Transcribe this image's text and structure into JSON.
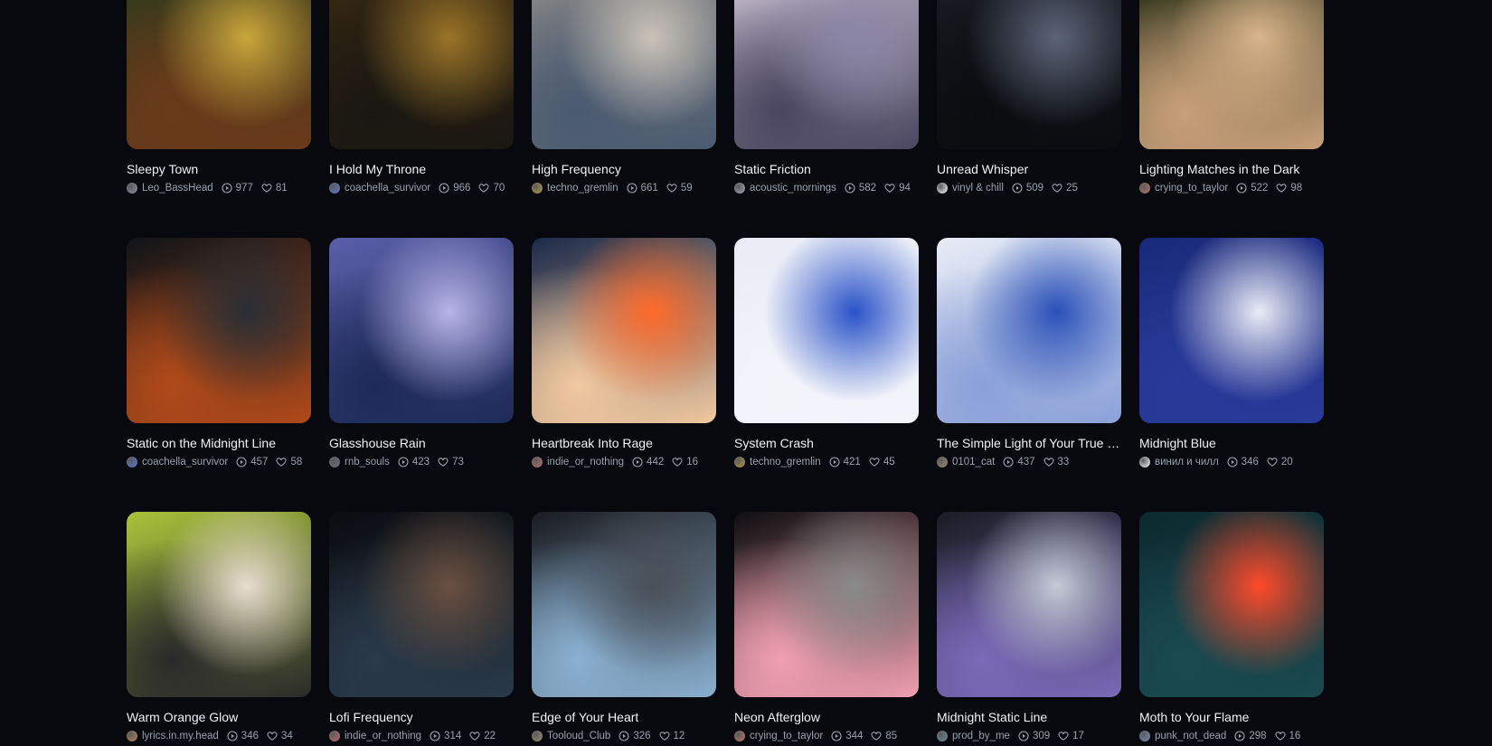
{
  "tracks": [
    {
      "title": "Sleepy Town",
      "author": "Leo_BassHead",
      "plays": "977",
      "likes": "81",
      "art": [
        "#2c3a1c",
        "#c9a63b",
        "#6b3a1a"
      ],
      "avatar": "#8a8f99"
    },
    {
      "title": "I Hold My Throne",
      "author": "coachella_survivor",
      "plays": "966",
      "likes": "70",
      "art": [
        "#3a2a12",
        "#9a7428",
        "#1a1712"
      ],
      "avatar": "#5b7bd6"
    },
    {
      "title": "High Frequency",
      "author": "techno_gremlin",
      "plays": "661",
      "likes": "59",
      "art": [
        "#8c8a86",
        "#c9c2b8",
        "#4a5a70"
      ],
      "avatar": "#b59a3a"
    },
    {
      "title": "Static Friction",
      "author": "acoustic_mornings",
      "plays": "582",
      "likes": "94",
      "art": [
        "#cfc6d6",
        "#8b86a6",
        "#4a4660"
      ],
      "avatar": "#a0a4ab"
    },
    {
      "title": "Unread Whisper",
      "author": "vinyl & chill",
      "plays": "509",
      "likes": "25",
      "art": [
        "#1a1d24",
        "#5b6478",
        "#0b0c10"
      ],
      "avatar": "#ffffff"
    },
    {
      "title": "Lighting Matches in the Dark",
      "author": "crying_to_taylor",
      "plays": "522",
      "likes": "98",
      "art": [
        "#1f2810",
        "#d9b48a",
        "#c8a07a"
      ],
      "avatar": "#c07060"
    },
    {
      "title": "Static on the Midnight Line",
      "author": "coachella_survivor",
      "plays": "457",
      "likes": "58",
      "art": [
        "#101418",
        "#2a2f36",
        "#b04a1a"
      ],
      "avatar": "#5b7bd6"
    },
    {
      "title": "Glasshouse Rain",
      "author": "rnb_souls",
      "plays": "423",
      "likes": "73",
      "art": [
        "#5a5fa8",
        "#b7b4e8",
        "#1e2a58"
      ],
      "avatar": "#6a6f78"
    },
    {
      "title": "Heartbreak Into Rage",
      "author": "indie_or_nothing",
      "plays": "442",
      "likes": "16",
      "art": [
        "#1b2a4a",
        "#ff6a2a",
        "#f2c9a0"
      ],
      "avatar": "#c06a70"
    },
    {
      "title": "System Crash",
      "author": "techno_gremlin",
      "plays": "421",
      "likes": "45",
      "art": [
        "#e9ecf6",
        "#2a52c8",
        "#f2f4fa"
      ],
      "avatar": "#b59a3a"
    },
    {
      "title": "The Simple Light of Your True Self",
      "author": "0101_cat",
      "plays": "437",
      "likes": "33",
      "art": [
        "#e8ecf6",
        "#2a50b8",
        "#8aa0d8"
      ],
      "avatar": "#a08a70"
    },
    {
      "title": "Midnight Blue",
      "author": "винил и чилл",
      "plays": "346",
      "likes": "20",
      "art": [
        "#1a2a7a",
        "#e9ecf6",
        "#2a3a9a"
      ],
      "avatar": "#ffffff"
    },
    {
      "title": "Warm Orange Glow",
      "author": "lyrics.in.my.head",
      "plays": "346",
      "likes": "34",
      "art": [
        "#a9c23a",
        "#e9ddd0",
        "#2a2a2a"
      ],
      "avatar": "#c08050"
    },
    {
      "title": "Lofi Frequency",
      "author": "indie_or_nothing",
      "plays": "314",
      "likes": "22",
      "art": [
        "#0a0c10",
        "#6a5040",
        "#2a3a4a"
      ],
      "avatar": "#c06a70"
    },
    {
      "title": "Edge of Your Heart",
      "author": "Tooloud_Club",
      "plays": "326",
      "likes": "12",
      "art": [
        "#1a1c20",
        "#4a5058",
        "#8ab0d0"
      ],
      "avatar": "#9a8a6a"
    },
    {
      "title": "Neon Afterglow",
      "author": "crying_to_taylor",
      "plays": "344",
      "likes": "85",
      "art": [
        "#0e0e10",
        "#8a8a8a",
        "#f0a0b0"
      ],
      "avatar": "#c07060"
    },
    {
      "title": "Midnight Static Line",
      "author": "prod_by_me",
      "plays": "309",
      "likes": "17",
      "art": [
        "#1a1c24",
        "#c4cad6",
        "#7a6ab8"
      ],
      "avatar": "#6a8aa0"
    },
    {
      "title": "Moth to Your Flame",
      "author": "punk_not_dead",
      "plays": "298",
      "likes": "16",
      "art": [
        "#0c2a30",
        "#ff4a2a",
        "#1a4a50"
      ],
      "avatar": "#7a8ab0"
    }
  ],
  "icons": {
    "plays": "play-circle-icon",
    "likes": "heart-icon"
  }
}
